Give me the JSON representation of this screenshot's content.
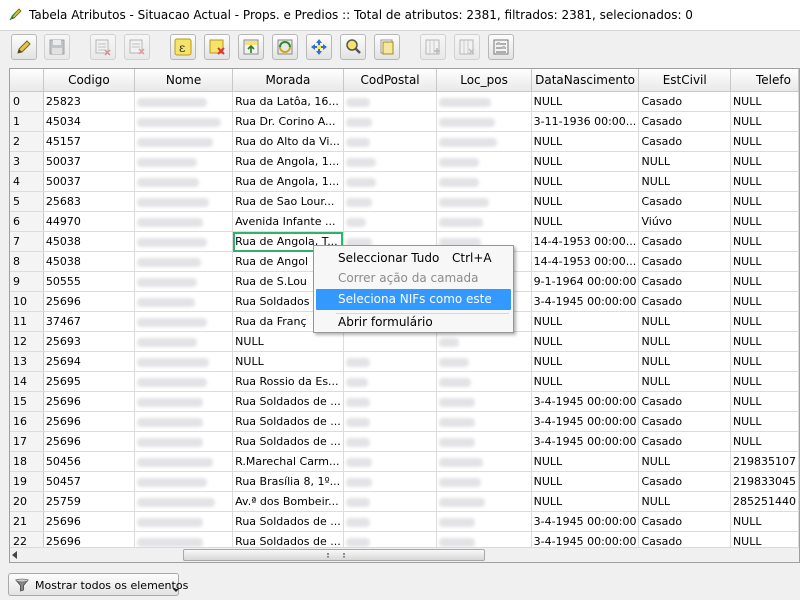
{
  "window": {
    "title": "Tabela Atributos - Situacao Actual - Props. e Predios :: Total de atributos: 2381, filtrados: 2381, selecionados: 0"
  },
  "toolbar": {
    "buttons": [
      {
        "name": "toggle-editing-button",
        "icon": "pencil-icon"
      },
      {
        "name": "save-edits-button",
        "icon": "floppy-disk-icon"
      },
      {
        "name": "delete-selected-button",
        "icon": "delete-rows-icon"
      },
      {
        "name": "select-by-expression-button",
        "icon": "epsilon-expression-icon"
      },
      {
        "name": "unselect-all-button",
        "icon": "unselect-icon"
      },
      {
        "name": "move-selection-top-button",
        "icon": "move-to-top-icon"
      },
      {
        "name": "invert-selection-button",
        "icon": "invert-selection-icon"
      },
      {
        "name": "pan-to-selection-button",
        "icon": "pan-map-icon"
      },
      {
        "name": "zoom-to-selection-button",
        "icon": "zoom-magnifier-icon"
      },
      {
        "name": "copy-selected-button",
        "icon": "copy-icon"
      },
      {
        "name": "new-column-button",
        "icon": "new-column-icon"
      },
      {
        "name": "delete-column-button",
        "icon": "delete-column-icon"
      },
      {
        "name": "field-calculator-button",
        "icon": "calculator-icon"
      }
    ]
  },
  "table": {
    "columns": [
      "",
      "Codigo",
      "Nome",
      "Morada",
      "CodPostal",
      "Loc_pos",
      "DataNascimento",
      "EstCivil",
      "Telefo"
    ],
    "rows": [
      {
        "idx": "0",
        "codigo": "25823",
        "morada": "Rua da Latôa, 16...",
        "data": "NULL",
        "estcivil": "Casado",
        "telefone": "NULL"
      },
      {
        "idx": "1",
        "codigo": "45034",
        "morada": "Rua Dr. Corino A...",
        "data": "3-11-1936 00:00...",
        "estcivil": "Casado",
        "telefone": "NULL"
      },
      {
        "idx": "2",
        "codigo": "45157",
        "morada": "Rua do Alto da Vi...",
        "data": "NULL",
        "estcivil": "Casado",
        "telefone": "NULL"
      },
      {
        "idx": "3",
        "codigo": "50037",
        "morada": "Rua de Angola, 1...",
        "data": "NULL",
        "estcivil": "NULL",
        "telefone": "NULL"
      },
      {
        "idx": "4",
        "codigo": "50037",
        "morada": "Rua de Angola, 1...",
        "data": "NULL",
        "estcivil": "NULL",
        "telefone": "NULL"
      },
      {
        "idx": "5",
        "codigo": "25683",
        "morada": "Rua de Sao Lour...",
        "data": "NULL",
        "estcivil": "Casado",
        "telefone": "NULL"
      },
      {
        "idx": "6",
        "codigo": "44970",
        "morada": "Avenida Infante ...",
        "data": "NULL",
        "estcivil": "Viúvo",
        "telefone": "NULL"
      },
      {
        "idx": "7",
        "codigo": "45038",
        "morada": "Rua de Angola, T...",
        "data": "14-4-1953 00:00...",
        "estcivil": "Casado",
        "telefone": "NULL"
      },
      {
        "idx": "8",
        "codigo": "45038",
        "morada": "Rua de Angol",
        "data": "14-4-1953 00:00...",
        "estcivil": "Casado",
        "telefone": "NULL"
      },
      {
        "idx": "9",
        "codigo": "50555",
        "morada": "Rua de S.Lou",
        "data": "9-1-1964 00:00:00",
        "estcivil": "Casado",
        "telefone": "NULL"
      },
      {
        "idx": "10",
        "codigo": "25696",
        "morada": "Rua Soldados",
        "data": "3-4-1945 00:00:00",
        "estcivil": "Casado",
        "telefone": "NULL"
      },
      {
        "idx": "11",
        "codigo": "37467",
        "morada": "Rua da Franç",
        "data": "NULL",
        "estcivil": "NULL",
        "telefone": "NULL"
      },
      {
        "idx": "12",
        "codigo": "25693",
        "morada": "NULL",
        "data": "NULL",
        "estcivil": "NULL",
        "telefone": "NULL"
      },
      {
        "idx": "13",
        "codigo": "25694",
        "morada": "NULL",
        "data": "NULL",
        "estcivil": "NULL",
        "telefone": "NULL"
      },
      {
        "idx": "14",
        "codigo": "25695",
        "morada": "Rua Rossio da Es...",
        "data": "NULL",
        "estcivil": "NULL",
        "telefone": "NULL"
      },
      {
        "idx": "15",
        "codigo": "25696",
        "morada": "Rua Soldados de ...",
        "data": "3-4-1945 00:00:00",
        "estcivil": "Casado",
        "telefone": "NULL"
      },
      {
        "idx": "16",
        "codigo": "25696",
        "morada": "Rua Soldados de ...",
        "data": "3-4-1945 00:00:00",
        "estcivil": "Casado",
        "telefone": "NULL"
      },
      {
        "idx": "17",
        "codigo": "25696",
        "morada": "Rua Soldados de ...",
        "data": "3-4-1945 00:00:00",
        "estcivil": "Casado",
        "telefone": "NULL"
      },
      {
        "idx": "18",
        "codigo": "50456",
        "morada": "R.Marechal Carm...",
        "data": "NULL",
        "estcivil": "NULL",
        "telefone": "219835107"
      },
      {
        "idx": "19",
        "codigo": "50457",
        "morada": "Rua Brasília 8, 1º...",
        "data": "NULL",
        "estcivil": "Casado",
        "telefone": "219833045"
      },
      {
        "idx": "20",
        "codigo": "25759",
        "morada": "Av.ª dos Bombeir...",
        "data": "NULL",
        "estcivil": "NULL",
        "telefone": "285251440"
      },
      {
        "idx": "21",
        "codigo": "25696",
        "morada": "Rua Soldados de ...",
        "data": "3-4-1945 00:00:00",
        "estcivil": "Casado",
        "telefone": "NULL"
      },
      {
        "idx": "22",
        "codigo": "25696",
        "morada": "Rua Soldados de ...",
        "data": "3-4-1945 00:00:00",
        "estcivil": "Casado",
        "telefone": "NULL"
      }
    ]
  },
  "context_menu": {
    "items": [
      {
        "label": "Seleccionar Tudo",
        "shortcut": "Ctrl+A",
        "state": "normal"
      },
      {
        "label": "Correr ação da camada",
        "shortcut": "",
        "state": "disabled"
      },
      {
        "label": "Seleciona NIFs como este",
        "shortcut": "",
        "state": "highlight"
      },
      {
        "label": "Abrir formulário",
        "shortcut": "",
        "state": "normal"
      }
    ]
  },
  "bottom": {
    "filter_button_label": "Mostrar todos os elementos",
    "filter_icon": "funnel-filter-icon"
  },
  "colors": {
    "menu_highlight": "#3399ff",
    "focus_cell_border": "#2fb36a"
  }
}
